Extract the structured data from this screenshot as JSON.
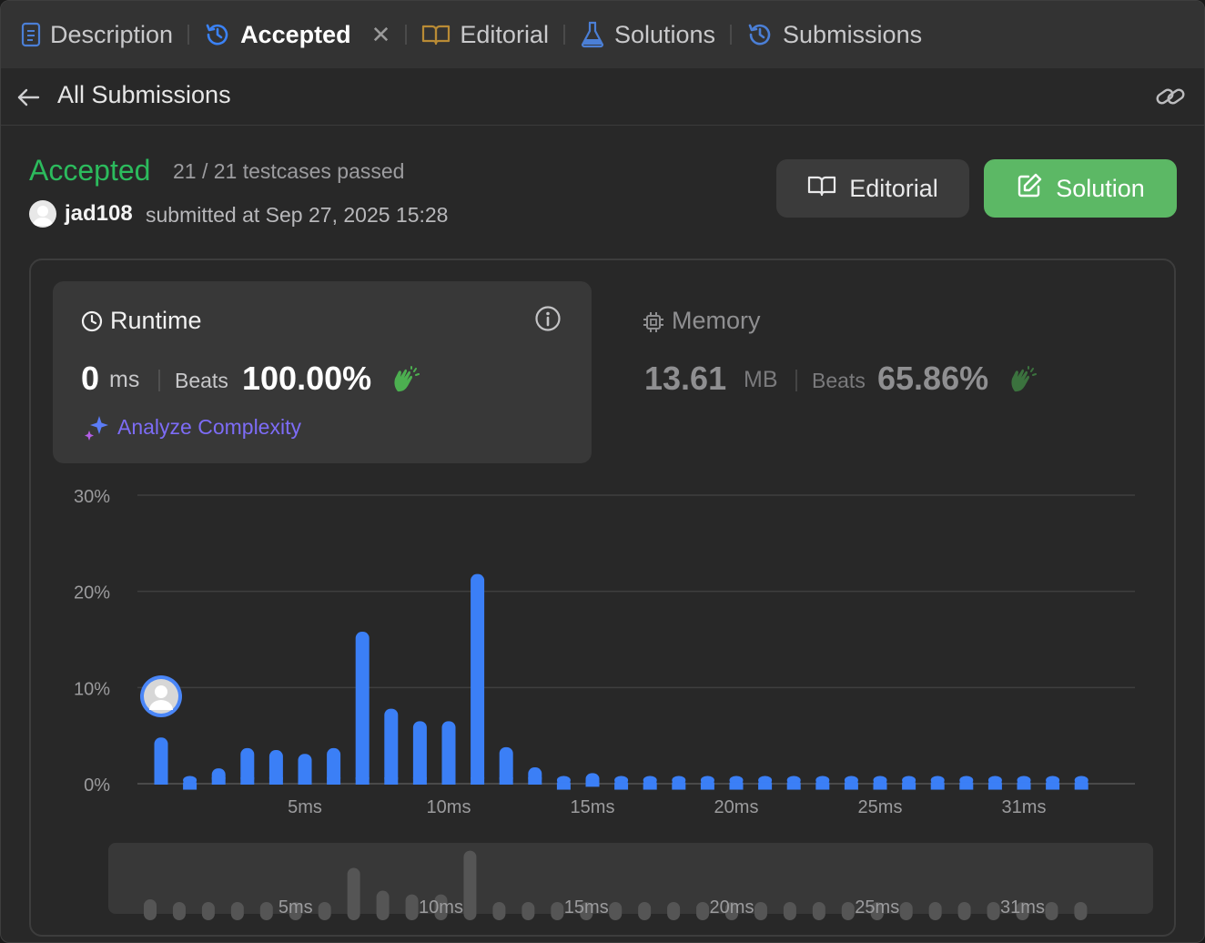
{
  "tabs": [
    {
      "label": "Description",
      "icon": "document-icon"
    },
    {
      "label": "Accepted",
      "icon": "history-icon",
      "active": true
    },
    {
      "label": "Editorial",
      "icon": "book-icon"
    },
    {
      "label": "Solutions",
      "icon": "flask-icon"
    },
    {
      "label": "Submissions",
      "icon": "history-icon"
    }
  ],
  "close_tab_glyph": "✕",
  "subheader": {
    "back_label": "All Submissions"
  },
  "submission": {
    "status": "Accepted",
    "testcases": "21 / 21 testcases passed",
    "username": "jad108",
    "submitted_at": "submitted at Sep 27, 2025 15:28"
  },
  "buttons": {
    "editorial": "Editorial",
    "solution": "Solution"
  },
  "runtime": {
    "title": "Runtime",
    "value": "0",
    "unit": "ms",
    "beats_label": "Beats",
    "beats_pct": "100.00%",
    "analyze": "Analyze Complexity"
  },
  "memory": {
    "title": "Memory",
    "value": "13.61",
    "unit": "MB",
    "beats_label": "Beats",
    "beats_pct": "65.86%"
  },
  "colors": {
    "accepted": "#2cbb5d",
    "bar": "#3b7ff6",
    "solution_btn": "#5cb865",
    "analyze": "#7d6cf6"
  },
  "chart_data": {
    "type": "bar",
    "title": "",
    "ylabel": "",
    "xlabel": "",
    "ylim": [
      0,
      30
    ],
    "yticks": [
      "30%",
      "20%",
      "10%",
      "0%"
    ],
    "xticks": [
      "5ms",
      "10ms",
      "15ms",
      "20ms",
      "25ms",
      "31ms"
    ],
    "values": [
      4.8,
      0.8,
      1.6,
      3.7,
      3.5,
      3.1,
      3.7,
      15.8,
      7.8,
      6.5,
      6.5,
      21.8,
      3.8,
      1.7,
      0.8,
      1.1,
      0.8,
      0.8,
      0.8,
      0.8,
      0.8,
      0.8,
      0.8,
      0.8,
      0.8,
      0.8,
      0.8,
      0.8,
      0.8,
      0.8,
      0.8,
      0.8,
      0.8
    ],
    "user_bar_index": 0,
    "grid": true
  }
}
